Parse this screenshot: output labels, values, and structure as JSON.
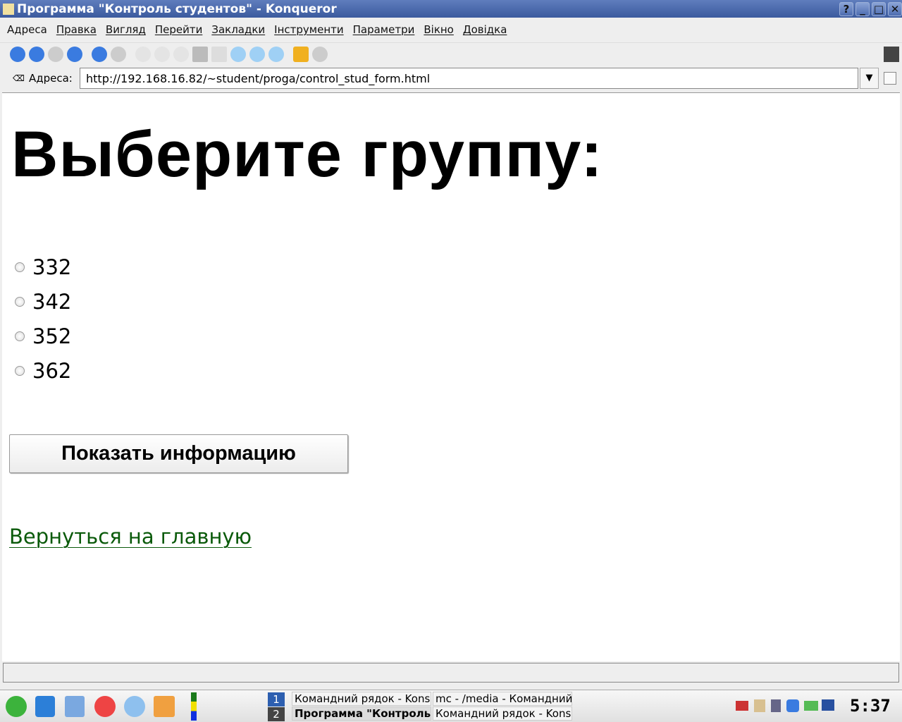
{
  "window": {
    "title": "Программа \"Контроль студентов\" - Konqueror",
    "buttons": [
      "?",
      "_",
      "□",
      "✕"
    ]
  },
  "menu": [
    "Адреса",
    "Правка",
    "Вигляд",
    "Перейти",
    "Закладки",
    "Інструменти",
    "Параметри",
    "Вікно",
    "Довідка"
  ],
  "address": {
    "label": "Адреса:",
    "url": "http://192.168.16.82/~student/proga/control_stud_form.html"
  },
  "page": {
    "heading": "Выберите группу:",
    "groups": [
      "332",
      "342",
      "352",
      "362"
    ],
    "submit_label": "Показать информацию",
    "back_link": "Вернуться на главную"
  },
  "taskbar": {
    "desktops": [
      "1",
      "2"
    ],
    "tasks": [
      "Командний рядок - Konsole",
      "mc - /media - Командний рядок",
      "Программа \"Контроль студентов\"",
      "Командний рядок - Konsole"
    ],
    "clock": "5:37"
  }
}
